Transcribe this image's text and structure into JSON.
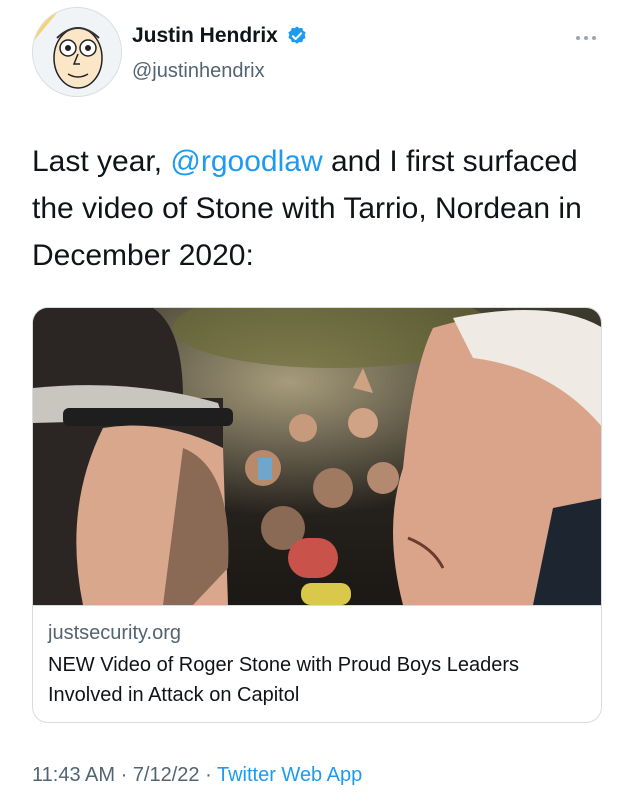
{
  "author": {
    "display_name": "Justin Hendrix",
    "handle": "@justinhendrix",
    "verified": true
  },
  "tweet": {
    "text_before": "Last year, ",
    "mention": "@rgoodlaw",
    "text_after": " and I first surfaced the video of Stone with Tarrio, Nordean in December 2020:"
  },
  "card": {
    "domain": "justsecurity.org",
    "title": "NEW Video of Roger Stone with Proud Boys Leaders Involved in Attack on Capitol"
  },
  "meta": {
    "time": "11:43 AM",
    "separator": " · ",
    "date": "7/12/22",
    "source": "Twitter Web App"
  },
  "colors": {
    "accent": "#1d9bf0",
    "secondary_text": "#536471",
    "primary_text": "#0f1419"
  },
  "icons": [
    "avatar-illustration",
    "verified-badge-icon",
    "more-options-icon"
  ]
}
